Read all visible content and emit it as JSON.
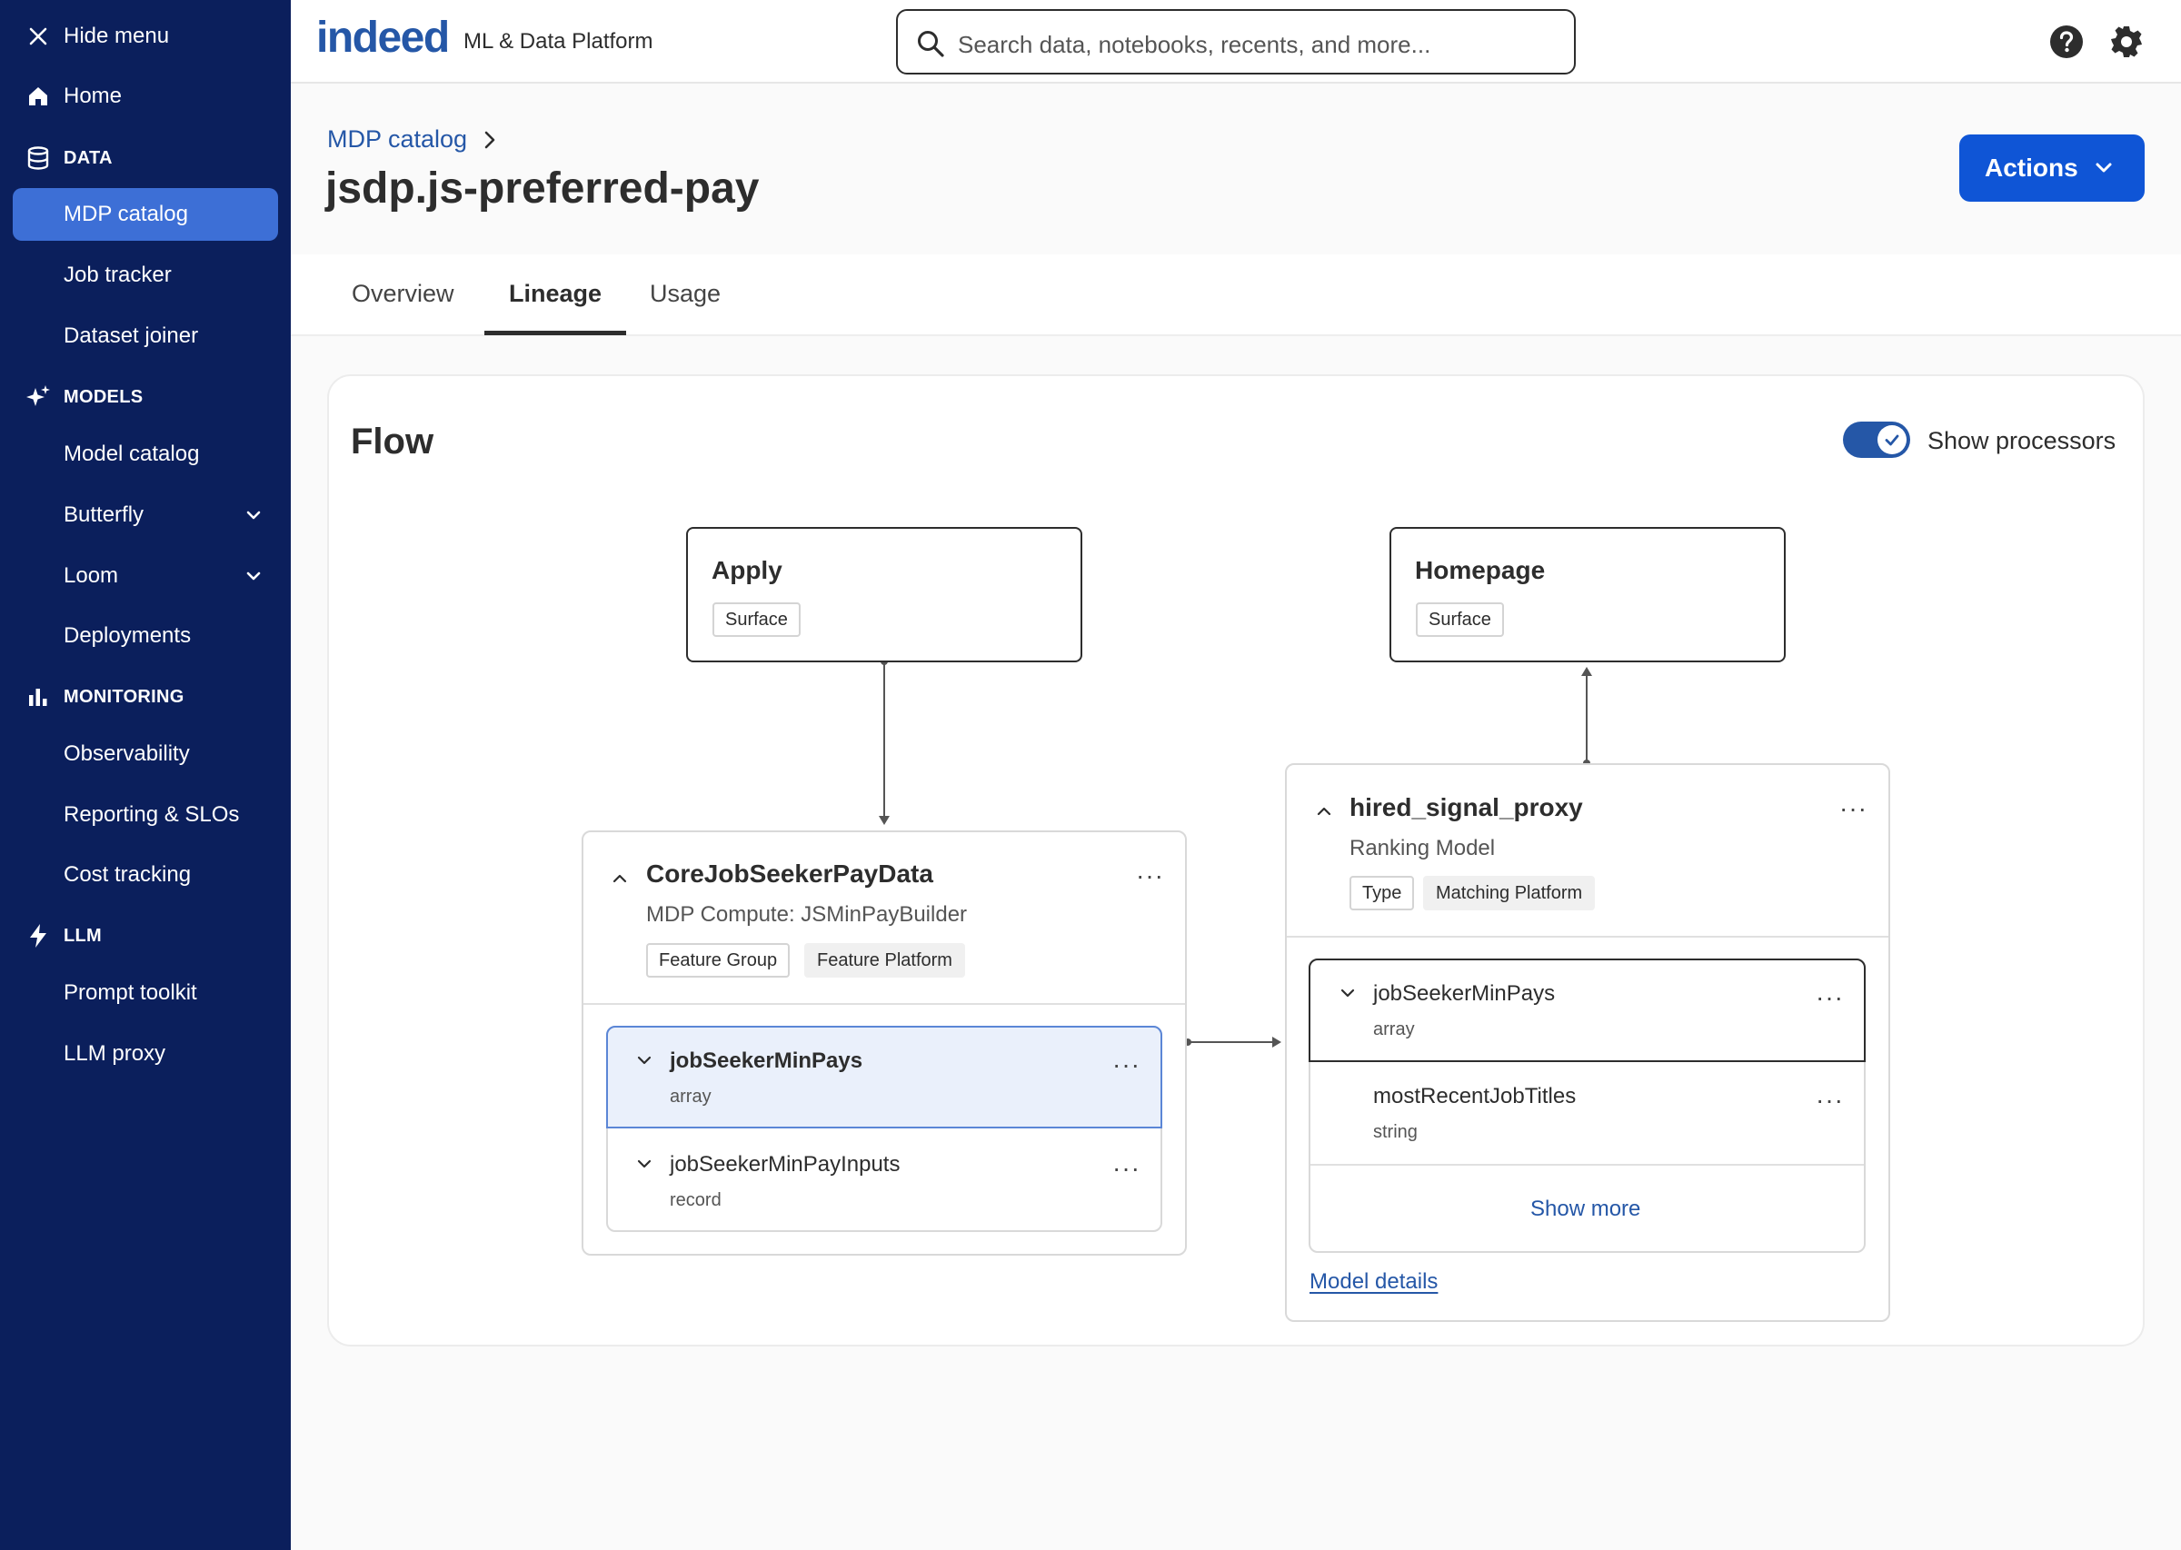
{
  "sidebar": {
    "hide_menu": "Hide menu",
    "home": "Home",
    "sections": {
      "data": "DATA",
      "models": "MODELS",
      "monitoring": "MONITORING",
      "llm": "LLM"
    },
    "items": {
      "mdp_catalog": "MDP catalog",
      "job_tracker": "Job tracker",
      "dataset_joiner": "Dataset joiner",
      "model_catalog": "Model catalog",
      "butterfly": "Butterfly",
      "loom": "Loom",
      "deployments": "Deployments",
      "observability": "Observability",
      "reporting": "Reporting & SLOs",
      "cost_tracking": "Cost tracking",
      "prompt_toolkit": "Prompt toolkit",
      "llm_proxy": "LLM proxy"
    },
    "active_item": "MDP catalog"
  },
  "header": {
    "logo": "indeed",
    "product": "ML & Data Platform",
    "search_placeholder": "Search data, notebooks, recents, and more..."
  },
  "page": {
    "breadcrumb": "MDP catalog",
    "title": "jsdp.js-preferred-pay",
    "actions_label": "Actions",
    "tabs": [
      "Overview",
      "Lineage",
      "Usage"
    ],
    "active_tab": "Lineage"
  },
  "flow": {
    "title": "Flow",
    "toggle_label": "Show processors",
    "toggle_on": true,
    "surfaces": [
      {
        "name": "Apply",
        "tag": "Surface"
      },
      {
        "name": "Homepage",
        "tag": "Surface"
      }
    ],
    "source_node": {
      "name": "CoreJobSeekerPayData",
      "subtitle": "MDP Compute: JSMinPayBuilder",
      "tags": [
        "Feature Group",
        "Feature Platform"
      ],
      "fields": [
        {
          "name": "jobSeekerMinPays",
          "type": "array",
          "selected": true
        },
        {
          "name": "jobSeekerMinPayInputs",
          "type": "record",
          "selected": false
        }
      ]
    },
    "model_node": {
      "name": "hired_signal_proxy",
      "subtitle": "Ranking Model",
      "tags": [
        "Type",
        "Matching Platform"
      ],
      "fields": [
        {
          "name": "jobSeekerMinPays",
          "type": "array"
        },
        {
          "name": "mostRecentJobTitles",
          "type": "string"
        }
      ],
      "show_more": "Show more",
      "details_link": "Model details"
    },
    "more_menu": "···"
  },
  "colors": {
    "sidebar_bg": "#0b1f5c",
    "sidebar_active": "#3d6fd6",
    "brand_blue": "#2557a7",
    "primary_button": "#0f55d6",
    "selected_field_bg": "#eaf0fb"
  }
}
